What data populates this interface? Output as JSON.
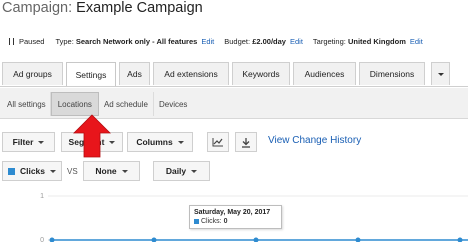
{
  "campaign": {
    "label": "Campaign:",
    "name": "Example Campaign"
  },
  "info": {
    "status": "Paused",
    "type_label": "Type:",
    "type_value": "Search Network only - All features",
    "type_edit": "Edit",
    "budget_label": "Budget:",
    "budget_value": "£2.00/day",
    "budget_edit": "Edit",
    "targeting_label": "Targeting:",
    "targeting_value": "United Kingdom",
    "targeting_edit": "Edit"
  },
  "tabs": [
    {
      "label": "Ad groups"
    },
    {
      "label": "Settings",
      "active": true
    },
    {
      "label": "Ads"
    },
    {
      "label": "Ad extensions"
    },
    {
      "label": "Keywords"
    },
    {
      "label": "Audiences"
    },
    {
      "label": "Dimensions"
    }
  ],
  "subtabs": [
    {
      "label": "All settings"
    },
    {
      "label": "Locations",
      "active": true
    },
    {
      "label": "Ad schedule"
    },
    {
      "label": "Devices"
    }
  ],
  "toolbar": {
    "filter_label": "Filter",
    "segment_label": "Segment",
    "columns_label": "Columns",
    "view_history_link": "View Change History"
  },
  "chart_controls": {
    "metric_label": "Clicks",
    "vs_label": "VS",
    "compare_label": "None",
    "interval_label": "Daily"
  },
  "chart": {
    "y_max_tick": "1",
    "y_min_tick": "0"
  },
  "tooltip": {
    "date": "Saturday, May 20, 2017",
    "metric_label": "Clicks:",
    "metric_value": "0"
  },
  "chart_data": {
    "type": "line",
    "x": [
      "",
      "",
      "",
      "",
      ""
    ],
    "series": [
      {
        "name": "Clicks",
        "values": [
          0,
          0,
          0,
          0,
          0
        ]
      }
    ],
    "ylim": [
      0,
      1
    ],
    "title": "",
    "xlabel": "",
    "ylabel": ""
  },
  "colors": {
    "accent": "#1a5fb4",
    "series": "#2e8bd0",
    "arrow": "#e8151b"
  }
}
